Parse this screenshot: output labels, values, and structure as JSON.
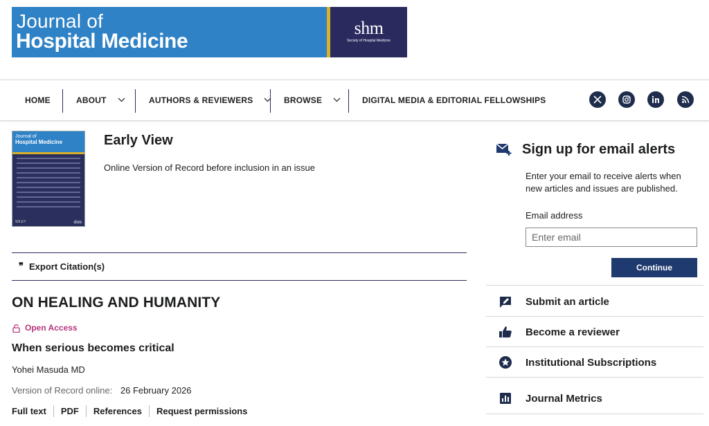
{
  "banner": {
    "journal_line1": "Journal of",
    "journal_line2": "Hospital Medicine",
    "society_logo": "shm",
    "society_name": "Society of Hospital Medicine",
    "colors": {
      "blue": "#2f82c6",
      "gold": "#d8b02a",
      "navy": "#2b2a5e"
    }
  },
  "nav": {
    "items": [
      {
        "label": "HOME",
        "has_dropdown": false
      },
      {
        "label": "ABOUT",
        "has_dropdown": true
      },
      {
        "label": "AUTHORS & REVIEWERS",
        "has_dropdown": true
      },
      {
        "label": "BROWSE",
        "has_dropdown": true
      },
      {
        "label": "DIGITAL MEDIA & EDITORIAL FELLOWSHIPS",
        "has_dropdown": false
      }
    ],
    "social": [
      "x-icon",
      "instagram-icon",
      "linkedin-icon",
      "rss-icon"
    ]
  },
  "issue": {
    "cover_line1": "Journal of",
    "cover_line2": "Hospital Medicine",
    "cover_publisher": "WILEY",
    "cover_society": "shm",
    "title": "Early View",
    "subtitle": "Online Version of Record before inclusion in an issue"
  },
  "export": {
    "label": "Export Citation(s)"
  },
  "article": {
    "section_heading": "ON HEALING AND HUMANITY",
    "access_label": "Open Access",
    "access_color": "#b7347b",
    "title": "When serious becomes critical",
    "author": "Yohei Masuda MD",
    "vor_label": "Version of Record online:",
    "vor_date": "26 February 2026",
    "links": [
      "Full text",
      "PDF",
      "References",
      "Request permissions"
    ]
  },
  "sidebar": {
    "alert_title": "Sign up for email alerts",
    "alert_desc": "Enter your email to receive alerts when new articles and issues are published.",
    "email_label": "Email address",
    "email_placeholder": "Enter email",
    "continue_label": "Continue",
    "items": [
      {
        "label": "Submit an article",
        "icon": "edit-icon"
      },
      {
        "label": "Become a reviewer",
        "icon": "thumbs-up-icon"
      },
      {
        "label": "Institutional Subscriptions",
        "icon": "star-icon"
      },
      {
        "label": "Journal Metrics",
        "icon": "bar-chart-icon"
      }
    ]
  }
}
